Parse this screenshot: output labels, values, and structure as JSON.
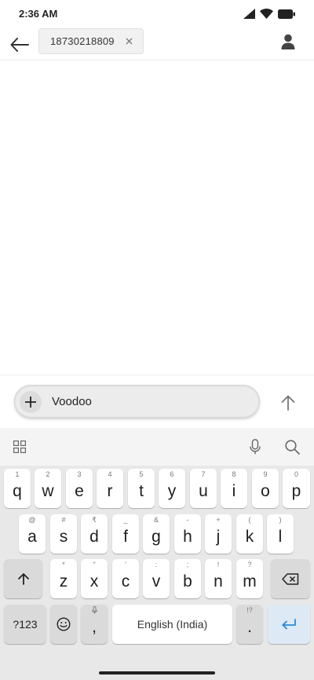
{
  "status_bar": {
    "time": "2:36 AM"
  },
  "header": {
    "recipient": "18730218809"
  },
  "compose": {
    "text": "Voodoo"
  },
  "keyboard": {
    "row1": [
      {
        "key": "q",
        "hint": "1"
      },
      {
        "key": "w",
        "hint": "2"
      },
      {
        "key": "e",
        "hint": "3"
      },
      {
        "key": "r",
        "hint": "4"
      },
      {
        "key": "t",
        "hint": "5"
      },
      {
        "key": "y",
        "hint": "6"
      },
      {
        "key": "u",
        "hint": "7"
      },
      {
        "key": "i",
        "hint": "8"
      },
      {
        "key": "o",
        "hint": "9"
      },
      {
        "key": "p",
        "hint": "0"
      }
    ],
    "row2": [
      {
        "key": "a",
        "hint": "@"
      },
      {
        "key": "s",
        "hint": "#"
      },
      {
        "key": "d",
        "hint": "₹"
      },
      {
        "key": "f",
        "hint": "_"
      },
      {
        "key": "g",
        "hint": "&"
      },
      {
        "key": "h",
        "hint": "-"
      },
      {
        "key": "j",
        "hint": "+"
      },
      {
        "key": "k",
        "hint": "("
      },
      {
        "key": "l",
        "hint": ")"
      }
    ],
    "row3": [
      {
        "key": "z",
        "hint": "*"
      },
      {
        "key": "x",
        "hint": "\""
      },
      {
        "key": "c",
        "hint": "'"
      },
      {
        "key": "v",
        "hint": ":"
      },
      {
        "key": "b",
        "hint": ";"
      },
      {
        "key": "n",
        "hint": "!"
      },
      {
        "key": "m",
        "hint": "?"
      }
    ],
    "symbols_label": "?123",
    "comma": ",",
    "space_label": "English (India)",
    "period": ".",
    "period_hint": "!?"
  }
}
